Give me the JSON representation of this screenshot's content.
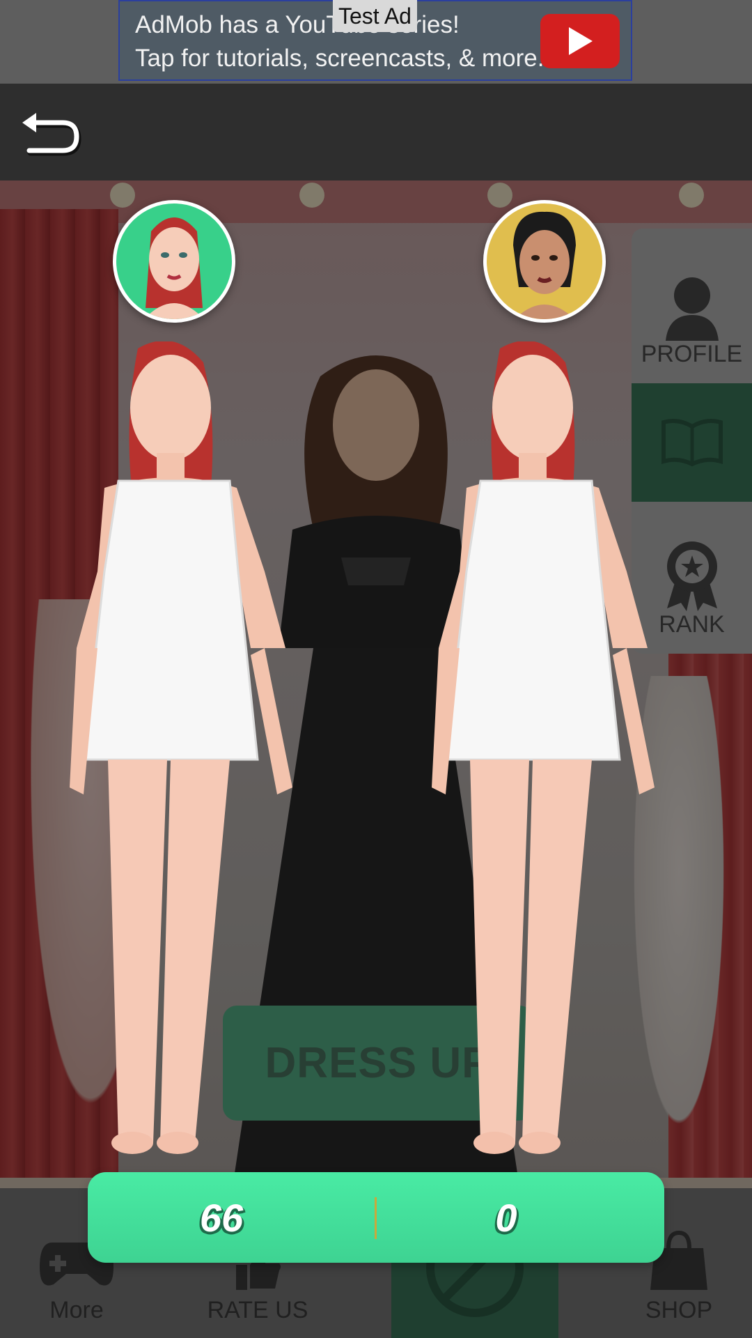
{
  "ad": {
    "badge": "Test Ad",
    "line1": "AdMob has a YouTube series!",
    "line2": "Tap for tutorials, screencasts, & more.",
    "play_icon": "youtube-play-icon",
    "colors": {
      "banner": "#4f5b65",
      "play": "#d31f1f"
    }
  },
  "header": {
    "back_icon": "back-arrow-icon",
    "background": "#2e2e2e"
  },
  "side_menu": {
    "items": [
      {
        "label": "PROFILE",
        "icon": "user-silhouette-icon"
      },
      {
        "label": "",
        "icon": "open-book-icon"
      },
      {
        "label": "RANK",
        "icon": "award-ribbon-icon"
      }
    ]
  },
  "background_button": {
    "label": "DRESS UP"
  },
  "bottom_nav": {
    "items": [
      {
        "label": "More",
        "icon": "gamepad-icon"
      },
      {
        "label": "RATE US",
        "icon": "thumbs-up-icon"
      },
      {
        "label": "",
        "icon": "no-ads-icon"
      },
      {
        "label": "SHOP",
        "icon": "shopping-bag-icon"
      }
    ]
  },
  "contestants": {
    "left": {
      "avatar_color": "#38d08a"
    },
    "right": {
      "avatar_color": "#e0be4e"
    }
  },
  "scores": {
    "left": "66",
    "right": "0",
    "bar_color": "#46e29d"
  }
}
